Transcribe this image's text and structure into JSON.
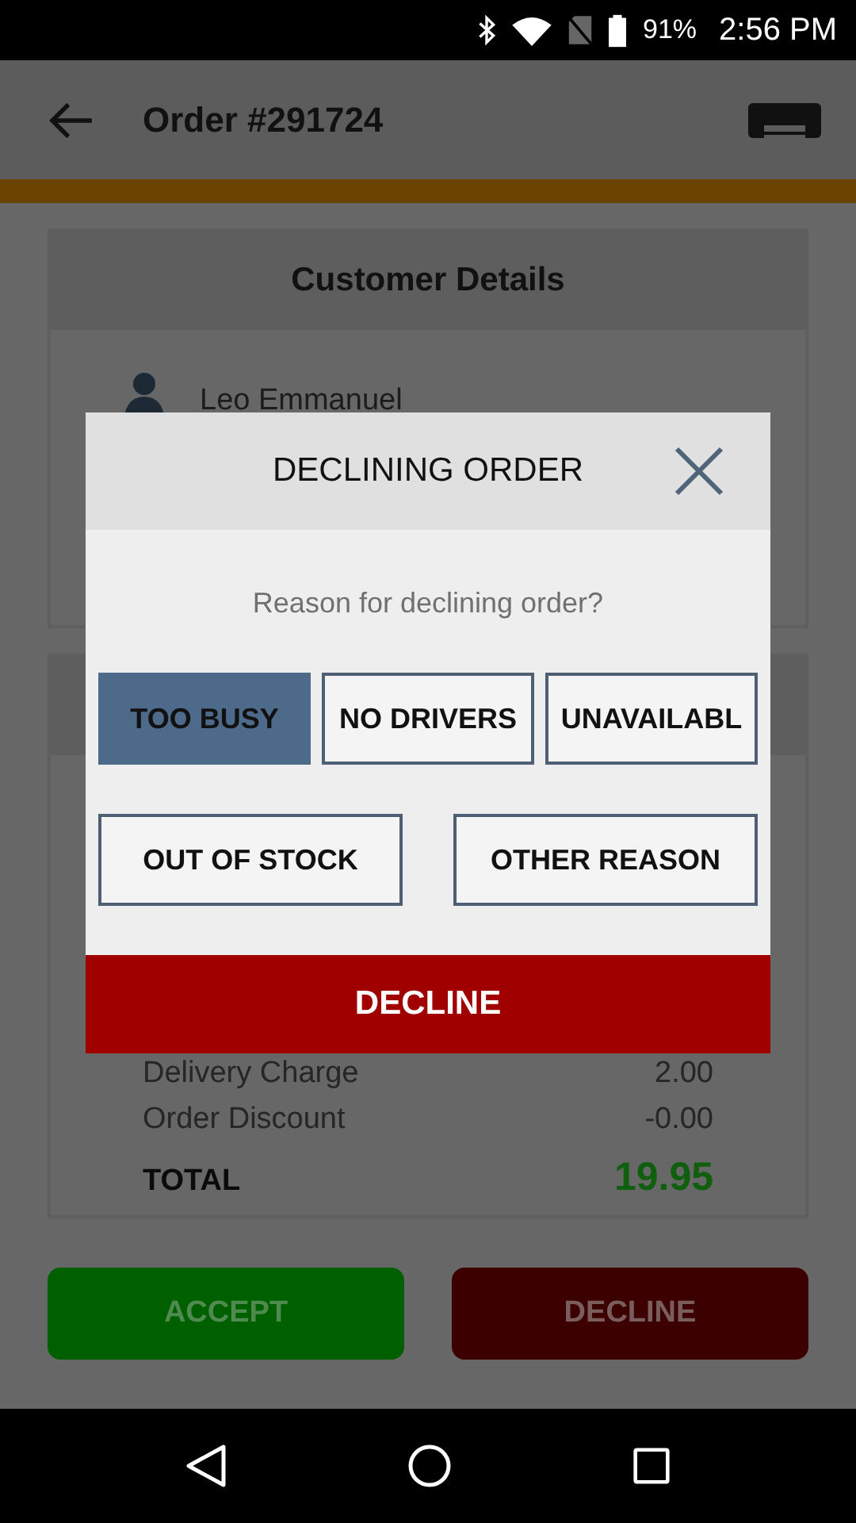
{
  "status_bar": {
    "battery": "91%",
    "time": "2:56 PM"
  },
  "app_bar": {
    "title": "Order #291724"
  },
  "customer": {
    "heading": "Customer Details",
    "name": "Leo Emmanuel"
  },
  "summary": [
    {
      "kind": "line",
      "label": "Delivery Charge",
      "value": "2.00"
    },
    {
      "kind": "line",
      "label": "Order Discount",
      "value": "-0.00"
    },
    {
      "kind": "total",
      "label": "TOTAL",
      "value": "19.95"
    }
  ],
  "actions": [
    {
      "kind": "accept",
      "label": "ACCEPT"
    },
    {
      "kind": "decline",
      "label": "DECLINE"
    }
  ],
  "dialog": {
    "title": "DECLINING ORDER",
    "prompt": "Reason for declining order?",
    "reasons": [
      {
        "label": "TOO BUSY",
        "selected": true
      },
      {
        "label": "NO DRIVERS",
        "selected": false
      },
      {
        "label": "UNAVAILABL",
        "selected": false
      },
      {
        "label": "OUT OF STOCK",
        "selected": false
      },
      {
        "label": "OTHER REASON",
        "selected": false
      }
    ],
    "confirm": "DECLINE"
  }
}
